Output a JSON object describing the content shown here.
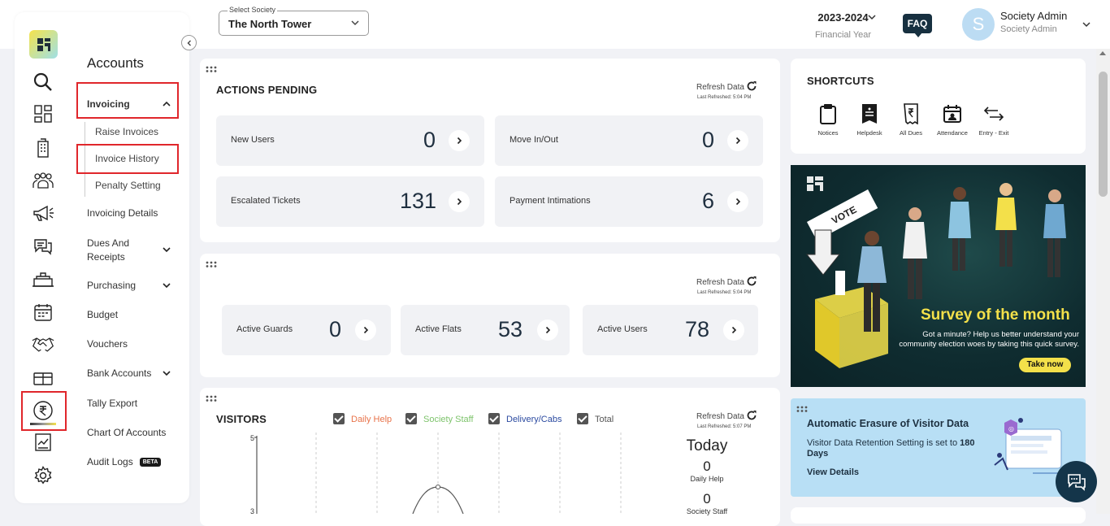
{
  "header": {
    "society_label": "Select Society",
    "society_value": "The North Tower",
    "year": "2023-2024",
    "year_sub": "Financial Year",
    "faq": "FAQ",
    "avatar_initial": "S",
    "user_name": "Society Admin",
    "user_role": "Society Admin"
  },
  "sidebar": {
    "title": "Accounts",
    "invoicing": "Invoicing",
    "raise_invoices": "Raise Invoices",
    "invoice_history": "Invoice History",
    "penalty_setting": "Penalty Setting",
    "invoicing_details": "Invoicing Details",
    "dues_line1": "Dues And",
    "dues_line2": "Receipts",
    "purchasing": "Purchasing",
    "budget": "Budget",
    "vouchers": "Vouchers",
    "bank_accounts": "Bank Accounts",
    "tally_export": "Tally Export",
    "chart_of_accounts": "Chart Of Accounts",
    "audit_logs": "Audit Logs",
    "beta": "BETA"
  },
  "actions": {
    "title": "ACTIONS PENDING",
    "refresh": "Refresh Data",
    "last_refreshed": "Last Refreshed: 5:04 PM",
    "new_users_label": "New Users",
    "new_users_value": "0",
    "move_label": "Move In/Out",
    "move_value": "0",
    "escalated_label": "Escalated Tickets",
    "escalated_value": "131",
    "payment_label": "Payment Intimations",
    "payment_value": "6"
  },
  "actives": {
    "refresh": "Refresh Data",
    "last_refreshed": "Last Refreshed: 5:04 PM",
    "guards_label": "Active Guards",
    "guards_value": "0",
    "flats_label": "Active Flats",
    "flats_value": "53",
    "users_label": "Active Users",
    "users_value": "78"
  },
  "visitors": {
    "title": "VISITORS",
    "refresh": "Refresh Data",
    "last_refreshed": "Last Refreshed: 5:07 PM",
    "legend": [
      {
        "label": "Daily Help",
        "color": "#e8734a"
      },
      {
        "label": "Society Staff",
        "color": "#7dc36b"
      },
      {
        "label": "Delivery/Cabs",
        "color": "#2b4aa0"
      },
      {
        "label": "Total",
        "color": "#555555"
      }
    ],
    "y_tick_top": "5",
    "y_tick_mid": "3",
    "today": "Today",
    "daily_help_value": "0",
    "daily_help_label": "Daily Help",
    "society_staff_value": "0",
    "society_staff_label": "Society Staff"
  },
  "shortcuts": {
    "title": "SHORTCUTS",
    "items": [
      "Notices",
      "Helpdesk",
      "All Dues",
      "Attendance",
      "Entry - Exit"
    ]
  },
  "survey": {
    "vote": "VOTE",
    "title": "Survey of the month",
    "desc1": "Got a minute? Help us better understand your",
    "desc2": "community election woes by taking this quick survey.",
    "cta": "Take now"
  },
  "erasure": {
    "title": "Automatic Erasure of Visitor Data",
    "text": "Visitor Data Retention Setting is set to",
    "days_line1": "180",
    "days_line2": "Days",
    "link": "View Details"
  }
}
